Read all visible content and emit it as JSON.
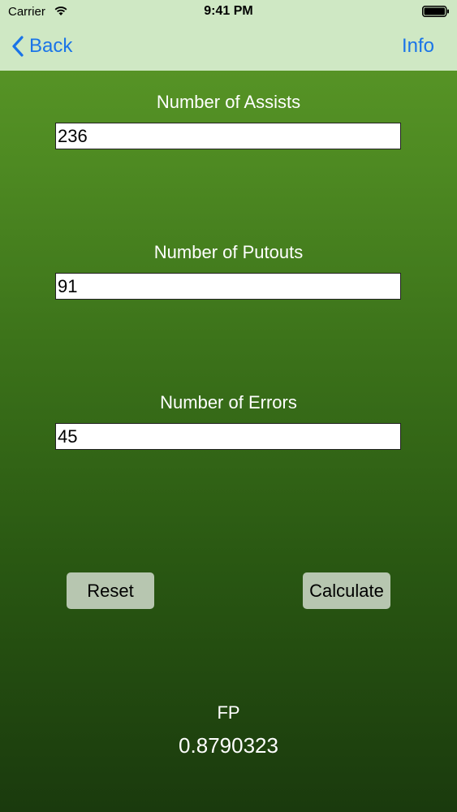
{
  "status_bar": {
    "carrier": "Carrier",
    "time": "9:41 PM",
    "wifi_icon": "wifi-icon",
    "battery_icon": "battery-icon"
  },
  "nav": {
    "back_label": "Back",
    "info_label": "Info",
    "accent_color": "#1a74e8"
  },
  "fields": {
    "assists": {
      "label": "Number of Assists",
      "value": "236"
    },
    "putouts": {
      "label": "Number of Putouts",
      "value": "91"
    },
    "errors": {
      "label": "Number of Errors",
      "value": "45"
    }
  },
  "buttons": {
    "reset_label": "Reset",
    "calculate_label": "Calculate"
  },
  "result": {
    "label": "FP",
    "value": "0.8790323"
  }
}
